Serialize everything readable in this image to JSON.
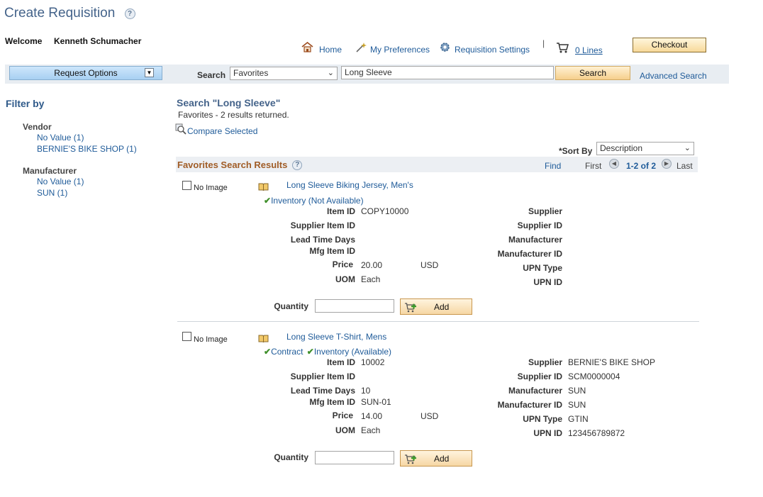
{
  "page": {
    "title": "Create Requisition"
  },
  "header": {
    "welcome": "Welcome",
    "user": "Kenneth Schumacher",
    "nav": {
      "home": "Home",
      "preferences": "My Preferences",
      "settings": "Requisition Settings",
      "lines": "0 Lines",
      "separator": "|"
    },
    "checkout": "Checkout"
  },
  "search": {
    "request_options": "Request Options",
    "label": "Search",
    "scope": "Favorites",
    "query": "Long Sleeve",
    "button": "Search",
    "advanced": "Advanced Search"
  },
  "filters": {
    "title": "Filter by",
    "groups": [
      {
        "name": "Vendor",
        "items": [
          "No Value (1)",
          "BERNIE'S BIKE SHOP (1)"
        ]
      },
      {
        "name": "Manufacturer",
        "items": [
          "No Value (1)",
          "SUN (1)"
        ]
      }
    ]
  },
  "results": {
    "heading": "Search \"Long Sleeve\"",
    "subtitle": "Favorites - 2 results returned.",
    "compare": "Compare Selected",
    "sort_label": "*Sort By",
    "sort_value": "Description",
    "grid_title": "Favorites Search Results",
    "find": "Find",
    "first": "First",
    "range": "1-2 of 2",
    "last": "Last",
    "labels": {
      "no_image": "No Image",
      "item_id": "Item ID",
      "supplier_item_id": "Supplier Item ID",
      "lead_time": "Lead Time Days",
      "mfg_item_id": "Mfg Item ID",
      "price": "Price",
      "uom": "UOM",
      "supplier": "Supplier",
      "supplier_id": "Supplier ID",
      "manufacturer": "Manufacturer",
      "manufacturer_id": "Manufacturer ID",
      "upn_type": "UPN Type",
      "upn_id": "UPN ID",
      "quantity": "Quantity",
      "add": "Add"
    },
    "items": [
      {
        "title": "Long Sleeve Biking Jersey, Men's",
        "contract": "",
        "availability": "Inventory (Not Available)",
        "item_id": "COPY10000",
        "supplier_item_id": "",
        "lead_time": "",
        "mfg_item_id": "",
        "price": "20.00",
        "currency": "USD",
        "uom": "Each",
        "supplier": "",
        "supplier_id": "",
        "manufacturer": "",
        "manufacturer_id": "",
        "upn_type": "",
        "upn_id": "",
        "quantity": ""
      },
      {
        "title": "Long Sleeve T-Shirt, Mens",
        "contract": "Contract",
        "availability": "Inventory (Available)",
        "item_id": "10002",
        "supplier_item_id": "",
        "lead_time": "10",
        "mfg_item_id": "SUN-01",
        "price": "14.00",
        "currency": "USD",
        "uom": "Each",
        "supplier": "BERNIE'S BIKE SHOP",
        "supplier_id": "SCM0000004",
        "manufacturer": "SUN",
        "manufacturer_id": "SUN",
        "upn_type": "GTIN",
        "upn_id": "123456789872",
        "quantity": ""
      }
    ]
  }
}
